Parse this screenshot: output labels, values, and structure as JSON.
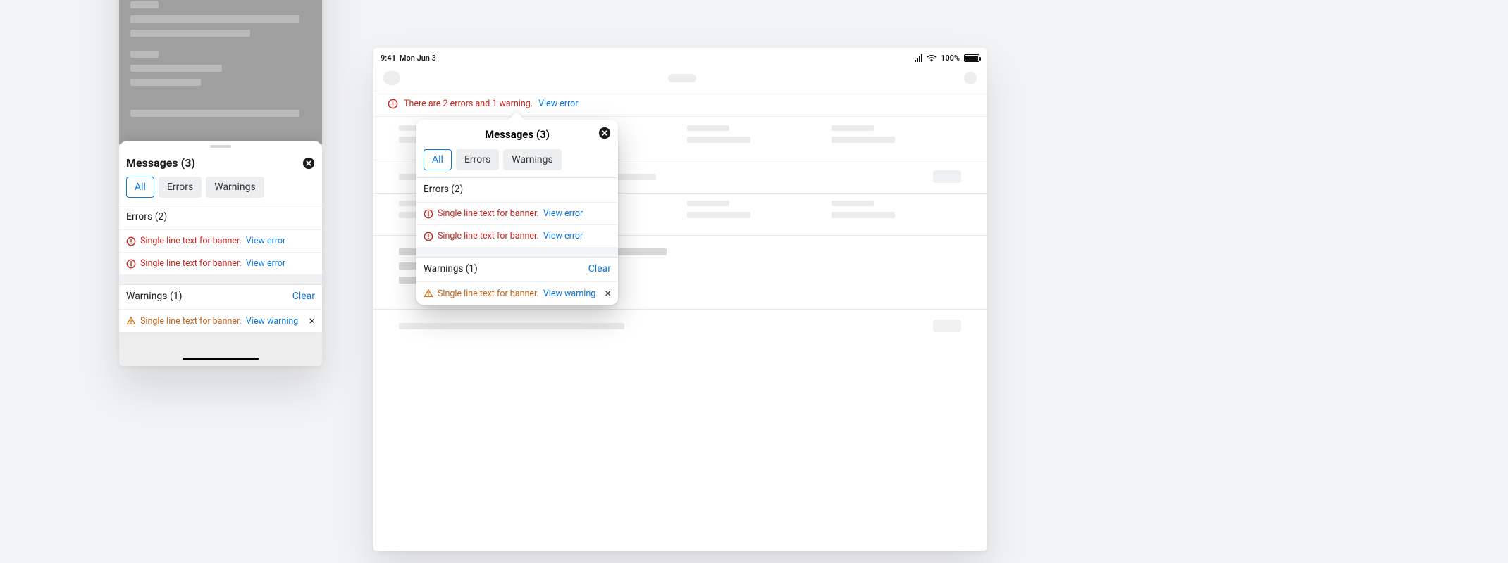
{
  "phone": {
    "sheet": {
      "title": "Messages (3)",
      "tabs": {
        "all": "All",
        "errors": "Errors",
        "warnings": "Warnings"
      },
      "errors_header": "Errors (2)",
      "error1_text": "Single line text for banner.",
      "error1_link": "View error",
      "error2_text": "Single line text for banner.",
      "error2_link": "View error",
      "warnings_header": "Warnings (1)",
      "clear_label": "Clear",
      "warning1_text": "Single line text for banner.",
      "warning1_link": "View warning"
    }
  },
  "tablet": {
    "status": {
      "time": "9:41",
      "date": "Mon Jun 3",
      "battery": "100%"
    },
    "banner": {
      "text": "There are 2 errors and 1 warning.",
      "link": "View error"
    },
    "popover": {
      "title": "Messages (3)",
      "tabs": {
        "all": "All",
        "errors": "Errors",
        "warnings": "Warnings"
      },
      "errors_header": "Errors (2)",
      "error1_text": "Single line text for banner.",
      "error1_link": "View error",
      "error2_text": "Single line text for banner.",
      "error2_link": "View error",
      "warnings_header": "Warnings (1)",
      "clear_label": "Clear",
      "warning1_text": "Single line text for banner.",
      "warning1_link": "View warning"
    }
  },
  "colors": {
    "error": "#c7261f",
    "warning": "#d27418",
    "link": "#0b77db"
  }
}
